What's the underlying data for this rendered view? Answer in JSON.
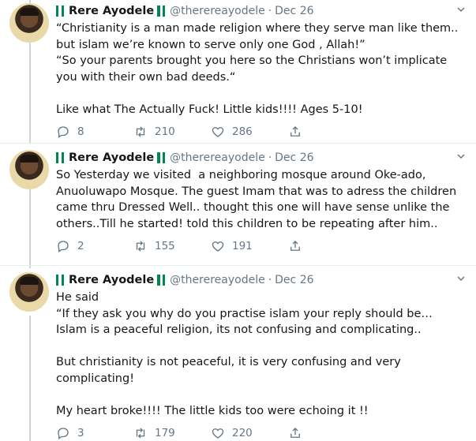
{
  "tweets": [
    {
      "name": "Rere Ayodele",
      "handle": "@therereayodele",
      "separator": "·",
      "date": "Dec 26",
      "text": "“Christianity is a man made religion where they serve man like them.. but islam we’re known to serve only one God , Allah!”\n“So your parents brought you here so the Christians won’t implicate you with their own bad deeds.“\n\nLike what The Actually Fuck! Little kids!!!! Ages 5-10!",
      "replies": "8",
      "retweets": "210",
      "likes": "286"
    },
    {
      "name": "Rere Ayodele",
      "handle": "@therereayodele",
      "separator": "·",
      "date": "Dec 26",
      "text": "So Yesterday we visited  a neighboring mosque around Oke-ado, Anuoluwapo Mosque. The guest Imam that was to adress the children came thru Dressed Well.. thought this one will have sense unlike the others..Till he started! told this children to be repeating after him..",
      "replies": "2",
      "retweets": "155",
      "likes": "191"
    },
    {
      "name": "Rere Ayodele",
      "handle": "@therereayodele",
      "separator": "·",
      "date": "Dec 26",
      "text": "He said\n“If they ask you why do you practise islam your reply should be…\nIslam is a peaceful religion, its not confusing and complicating..\n\nBut christianity is not peaceful, it is very confusing and very complicating!\n\nMy heart broke!!!! The little kids too were echoing it !!",
      "replies": "3",
      "retweets": "179",
      "likes": "220"
    }
  ],
  "icons": {
    "reply": "reply-icon",
    "retweet": "retweet-icon",
    "like": "heart-icon",
    "share": "share-icon",
    "more": "chevron-down-icon",
    "flag": "nigeria-flag-icon"
  },
  "colors": {
    "text": "#14171a",
    "muted": "#657786",
    "thread_line": "#ccd6dd",
    "divider": "#e6ecf0",
    "flag_green": "#008751"
  }
}
